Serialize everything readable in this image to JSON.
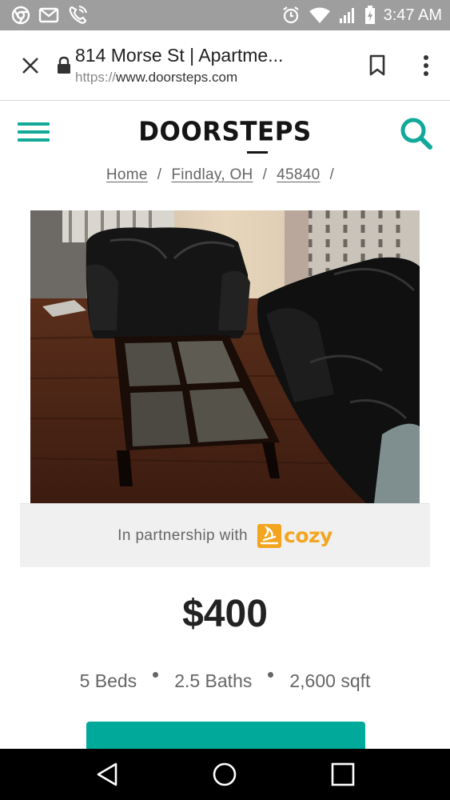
{
  "status_bar": {
    "time": "3:47 AM",
    "icons": [
      "chrome-icon",
      "gmail-icon",
      "wifi-calling-icon",
      "alarm-icon",
      "wifi-icon",
      "signal-icon",
      "battery-icon"
    ]
  },
  "browser": {
    "page_title": "814 Morse St | Apartme...",
    "url_scheme": "https://",
    "url_host": "www.doorsteps.com",
    "icons": [
      "close-icon",
      "lock-icon",
      "bookmark-icon",
      "more-vert-icon"
    ]
  },
  "site": {
    "logo": "DOORSTEPS",
    "accent_color": "#12a99a"
  },
  "breadcrumb": [
    {
      "label": "Home"
    },
    {
      "label": "Findlay, OH"
    },
    {
      "label": "45840"
    }
  ],
  "breadcrumb_separator": "/",
  "partnership": {
    "text": "In partnership with",
    "partner_name": "cozy",
    "partner_color": "#f3a51f"
  },
  "listing": {
    "price": "$400",
    "beds": "5 Beds",
    "baths": "2.5 Baths",
    "area": "2,600 sqft"
  },
  "nav_bar": {
    "icons": [
      "back-icon",
      "home-icon",
      "recents-icon"
    ]
  }
}
